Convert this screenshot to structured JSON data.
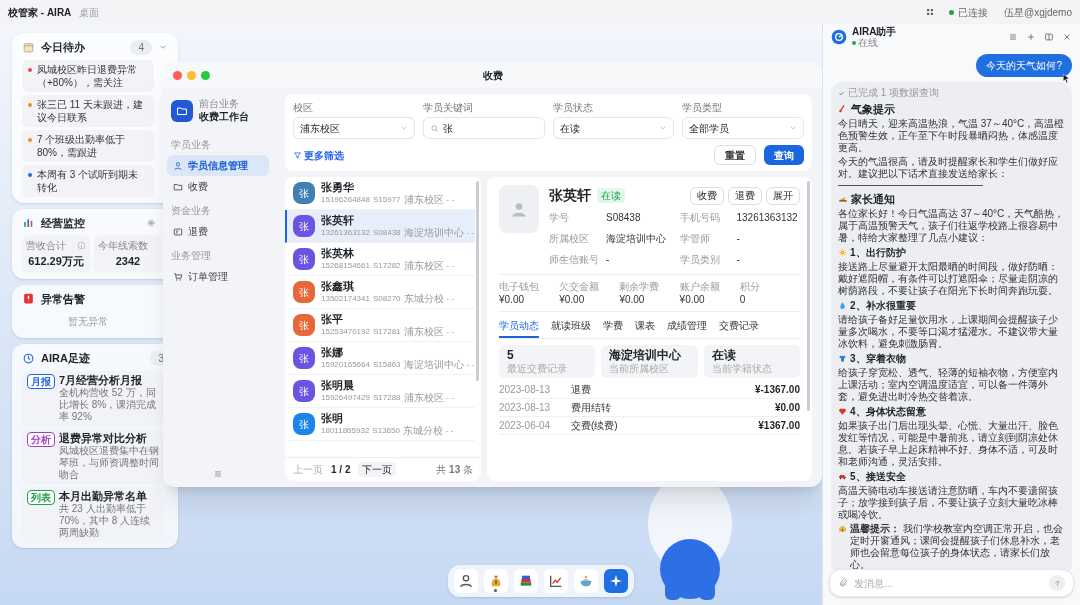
{
  "top_bar": {
    "app_title": "校管家 - AIRA",
    "context": "桌面",
    "connection": "已连接",
    "user": "伍星@xgjdemo"
  },
  "todo": {
    "title": "今日待办",
    "count": "4",
    "items": [
      {
        "text": "凤城校区昨日退费异常（+80%），需关注",
        "color": "#e5484d"
      },
      {
        "text": "张三已 11 天未跟进，建议今日联系",
        "color": "#f08a24"
      },
      {
        "text": "7 个班级出勤率低于 80%，需跟进",
        "color": "#f08a24"
      },
      {
        "text": "本周有 3 个试听到期未转化",
        "color": "#2563eb"
      }
    ]
  },
  "monitor": {
    "title": "经营监控",
    "stats": [
      {
        "label": "营收合计",
        "value": "612.29万元"
      },
      {
        "label": "今年线索数",
        "value": "2342"
      }
    ]
  },
  "alerts": {
    "title": "异常告警",
    "empty_text": "暂无异常"
  },
  "footprints": {
    "title": "AIRA足迹",
    "count": "3",
    "items": [
      {
        "tag": "月报",
        "color": "#2563eb",
        "title": "7月经营分析月报",
        "desc": "全机构营收 52 万，同比增长 8%，课消完成率 92%"
      },
      {
        "tag": "分析",
        "color": "#a33fc4",
        "title": "退费异常对比分析",
        "desc": "凤城校区退费集中在钢琴班，与师资调整时间吻合"
      },
      {
        "tag": "列表",
        "color": "#23a04f",
        "title": "本月出勤异常名单",
        "desc": "共 23 人出勤率低于 70%，其中 8 人连续两周缺勤"
      }
    ]
  },
  "window": {
    "title": "收费",
    "sidebar": {
      "subtitle": "前台业务",
      "title": "收费工作台",
      "groups": [
        {
          "label": "学员业务",
          "items": [
            {
              "label": "学员信息管理",
              "selected": true
            },
            {
              "label": "收费",
              "selected": false
            }
          ]
        },
        {
          "label": "资金业务",
          "items": [
            {
              "label": "退费",
              "selected": false
            }
          ]
        },
        {
          "label": "业务管理",
          "items": [
            {
              "label": "订单管理",
              "selected": false
            }
          ]
        }
      ]
    },
    "filters": [
      {
        "kind": "select",
        "label": "校区",
        "value": "浦东校区"
      },
      {
        "kind": "search",
        "label": "学员关键词",
        "value": "张"
      },
      {
        "kind": "select",
        "label": "学员状态",
        "value": "在读"
      },
      {
        "kind": "select",
        "label": "学员类型",
        "value": "全部学员"
      }
    ],
    "more_filters": "更多筛选",
    "buttons": [
      {
        "label": "重置",
        "primary": false
      },
      {
        "label": "查询",
        "primary": true
      }
    ],
    "students": [
      {
        "avatar": "张",
        "name": "张勇华",
        "phone": "15196264848",
        "id": "S15977",
        "campus": "浦东校区",
        "extra": "- -",
        "color": "#3f7fb4",
        "selected": false
      },
      {
        "avatar": "张",
        "name": "张英轩",
        "phone": "13261363132",
        "id": "S08438",
        "campus": "海淀培训中心",
        "extra": "- -",
        "color": "#6a55e0",
        "selected": true
      },
      {
        "avatar": "张",
        "name": "张英林",
        "phone": "15268154661",
        "id": "S17282",
        "campus": "浦东校区",
        "extra": "- -",
        "color": "#6a55e0",
        "selected": false
      },
      {
        "avatar": "张",
        "name": "张鑫琪",
        "phone": "13502174341",
        "id": "S08270",
        "campus": "东城分校",
        "extra": "- -",
        "color": "#e5673a",
        "selected": false
      },
      {
        "avatar": "张",
        "name": "张平",
        "phone": "15253470192",
        "id": "S17281",
        "campus": "浦东校区",
        "extra": "- -",
        "color": "#e5673a",
        "selected": false
      },
      {
        "avatar": "张",
        "name": "张娜",
        "phone": "15920165664",
        "id": "S15863",
        "campus": "海淀培训中心",
        "extra": "- -",
        "color": "#6a55e0",
        "selected": false
      },
      {
        "avatar": "张",
        "name": "张明晨",
        "phone": "15926497429",
        "id": "S17288",
        "campus": "浦东校区",
        "extra": "- -",
        "color": "#6a55e0",
        "selected": false
      },
      {
        "avatar": "张",
        "name": "张明",
        "phone": "18011865932",
        "id": "S13650",
        "campus": "东城分校",
        "extra": "- -",
        "color": "#1a86ec",
        "selected": false
      }
    ],
    "pagination": {
      "prev": "上一页",
      "page": "1 / 2",
      "next": "下一页",
      "total": "共 **13** 条"
    },
    "detail": {
      "name": "张英轩",
      "status": "在读",
      "actions": [
        "收费",
        "退费",
        "展开"
      ],
      "fields": [
        {
          "label": "学号",
          "value": "S08438"
        },
        {
          "label": "手机号码",
          "value": "13261363132"
        },
        {
          "label": "所属校区",
          "value": "海淀培训中心"
        },
        {
          "label": "学管师",
          "value": "-"
        },
        {
          "label": "师生信账号",
          "value": "-"
        },
        {
          "label": "学员类别",
          "value": "-"
        }
      ],
      "balances": [
        {
          "label": "电子钱包",
          "value": "¥0.00"
        },
        {
          "label": "欠交金额",
          "value": "¥0.00"
        },
        {
          "label": "剩余学费",
          "value": "¥0.00"
        },
        {
          "label": "账户余额",
          "value": "¥0.00"
        },
        {
          "label": "积分",
          "value": "0"
        }
      ],
      "tabs": [
        {
          "label": "学员动态",
          "selected": true
        },
        {
          "label": "就读班级",
          "selected": false
        },
        {
          "label": "学费",
          "selected": false
        },
        {
          "label": "课表",
          "selected": false
        },
        {
          "label": "成绩管理",
          "selected": false
        },
        {
          "label": "交费记录",
          "selected": false
        }
      ],
      "summary": [
        {
          "value": "5",
          "label": "最近交费记录"
        },
        {
          "value": "海淀培训中心",
          "label": "当前所属校区"
        },
        {
          "value": "在读",
          "label": "当前学籍状态"
        }
      ],
      "records": [
        {
          "date": "2023-08-13",
          "type": "退费",
          "amount": "¥-1367.00"
        },
        {
          "date": "2023-08-13",
          "type": "费用结转",
          "amount": "¥0.00"
        },
        {
          "date": "2023-06-04",
          "type": "交费(续费)",
          "amount": "¥1367.00"
        }
      ]
    }
  },
  "dock": [
    {
      "selected": false,
      "running": false
    },
    {
      "selected": false,
      "running": true
    },
    {
      "selected": false,
      "running": false
    },
    {
      "selected": false,
      "running": false
    },
    {
      "selected": false,
      "running": false
    },
    {
      "selected": true,
      "running": false
    }
  ],
  "assistant": {
    "title": "AIRA助手",
    "status": "在线",
    "placeholder": "发消息...",
    "messages": [
      {
        "kind": "user",
        "text": "今天的天气如何?"
      },
      {
        "kind": "assistant",
        "status": "已完成 1 项数据查询",
        "blocks": [
          {
            "kind": "heading",
            "text": "气象提示"
          },
          {
            "kind": "paragraph",
            "text": "今日晴天，迎来高温热浪，气温 37～40°C，高温橙色预警生效，正午至下午时段暴晒闷热，体感温度更高。"
          },
          {
            "kind": "paragraph",
            "text": "今天的气温很高，请及时提醒家长和学生们做好应对。建议把以下话术直接发送给家长："
          },
          {
            "kind": "divider"
          },
          {
            "kind": "heading",
            "text": "家长通知"
          },
          {
            "kind": "paragraph",
            "text": "各位家长好！今日气温高达 37～40°C，天气酷热，属于高温预警天气，孩子们往返学校路上很容易中暑，特给大家整理了几点小建议："
          },
          {
            "kind": "subheading",
            "text": "1、出行防护"
          },
          {
            "kind": "paragraph",
            "text": "接送路上尽量避开太阳最晒的时间段，做好防晒：戴好遮阳帽，有条件可以打遮阳伞；尽量走阴凉的树荫路段，不要让孩子在阳光下长时间奔跑玩耍。"
          },
          {
            "kind": "subheading",
            "text": "2、补水很重要"
          },
          {
            "kind": "paragraph",
            "text": "请给孩子备好足量饮用水，上课期间会提醒孩子少量多次喝水，不要等口渴才猛灌水。不建议带大量冰饮料，避免刺激肠胃。"
          },
          {
            "kind": "subheading",
            "text": "3、穿着衣物"
          },
          {
            "kind": "paragraph",
            "text": "给孩子穿宽松、透气、轻薄的短袖衣物，方便室内上课活动；室内空调温度适宜，可以备一件薄外套，避免进出时冷热交替着凉。"
          },
          {
            "kind": "subheading",
            "text": "4、身体状态留意"
          },
          {
            "kind": "paragraph",
            "text": "如果孩子出门后出现头晕、心慌、大量出汗、脸色发红等情况，可能是中暑前兆，请立刻到阴凉处休息。若孩子早上起床精神不好、身体不适，可及时和老师沟通，灵活安排。"
          },
          {
            "kind": "subheading",
            "text": "5、接送安全"
          },
          {
            "kind": "paragraph",
            "text": "高温天骑电动车接送请注意防晒，车内不要遗留孩子；放学接到孩子后，不要让孩子立刻大量吃冰棒或喝冷饮。"
          },
          {
            "kind": "tip",
            "text": "**温馨提示：** 我们学校教室内空调正常开启，也会定时开窗通风；课间会提醒孩子们休息补水，老师也会留意每位孩子的身体状态，请家长们放心。"
          }
        ]
      }
    ]
  }
}
